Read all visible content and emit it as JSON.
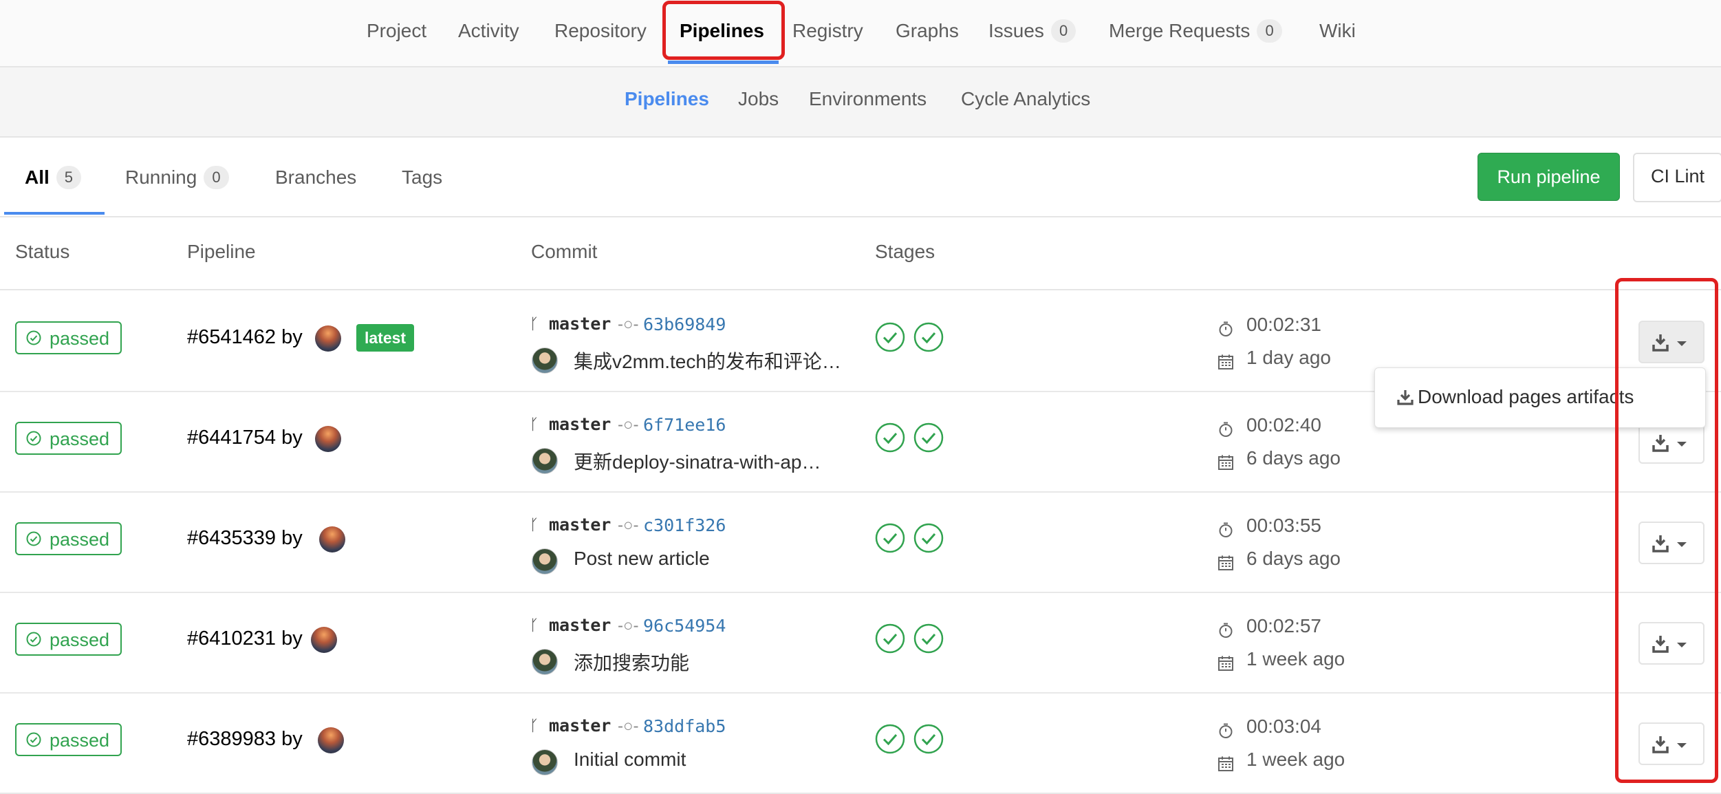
{
  "top_nav": {
    "items": [
      {
        "label": "Project"
      },
      {
        "label": "Activity"
      },
      {
        "label": "Repository"
      },
      {
        "label": "Pipelines"
      },
      {
        "label": "Registry"
      },
      {
        "label": "Graphs"
      },
      {
        "label": "Issues",
        "count": "0"
      },
      {
        "label": "Merge Requests",
        "count": "0"
      },
      {
        "label": "Wiki"
      }
    ]
  },
  "sub_nav": {
    "items": [
      {
        "label": "Pipelines"
      },
      {
        "label": "Jobs"
      },
      {
        "label": "Environments"
      },
      {
        "label": "Cycle Analytics"
      }
    ]
  },
  "scope_tabs": [
    {
      "label": "All",
      "count": "5"
    },
    {
      "label": "Running",
      "count": "0"
    },
    {
      "label": "Branches"
    },
    {
      "label": "Tags"
    }
  ],
  "actions": {
    "run_pipeline": "Run pipeline",
    "ci_lint": "CI Lint"
  },
  "table": {
    "headers": {
      "status": "Status",
      "pipeline": "Pipeline",
      "commit": "Commit",
      "stages": "Stages"
    },
    "rows": [
      {
        "status": "passed",
        "id": "#6541462 by",
        "latest": "latest",
        "branch": "master",
        "sha": "63b69849",
        "message": "集成v2mm.tech的发布和评论…",
        "duration": "00:02:31",
        "ago": "1 day ago"
      },
      {
        "status": "passed",
        "id": "#6441754 by",
        "branch": "master",
        "sha": "6f71ee16",
        "message": "更新deploy-sinatra-with-ap…",
        "duration": "00:02:40",
        "ago": "6 days ago"
      },
      {
        "status": "passed",
        "id": "#6435339 by",
        "branch": "master",
        "sha": "c301f326",
        "message": "Post new article",
        "duration": "00:03:55",
        "ago": "6 days ago"
      },
      {
        "status": "passed",
        "id": "#6410231 by",
        "branch": "master",
        "sha": "96c54954",
        "message": "添加搜索功能",
        "duration": "00:02:57",
        "ago": "1 week ago"
      },
      {
        "status": "passed",
        "id": "#6389983 by",
        "branch": "master",
        "sha": "83ddfab5",
        "message": "Initial commit",
        "duration": "00:03:04",
        "ago": "1 week ago"
      }
    ]
  },
  "dropdown": {
    "item": "Download pages artifacts"
  },
  "colors": {
    "accent": "#4a8bee",
    "success": "#2fab52",
    "highlight": "#e02020"
  }
}
